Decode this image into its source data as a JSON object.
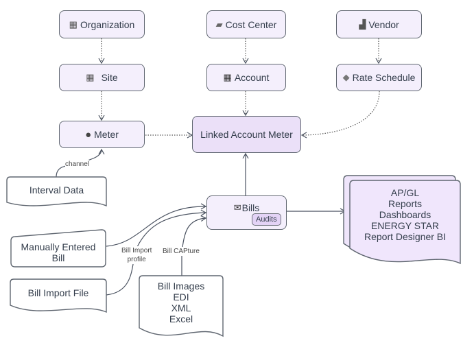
{
  "nodes": {
    "organization": {
      "label": "Organization",
      "icon": "building-icon"
    },
    "cost_center": {
      "label": "Cost Center",
      "icon": "folder-icon"
    },
    "vendor": {
      "label": "Vendor",
      "icon": "factory-icon"
    },
    "site": {
      "label": "Site",
      "icon": "office-building-icon"
    },
    "account": {
      "label": "Account",
      "icon": "calculator-icon"
    },
    "rate_schedule": {
      "label": "Rate Schedule",
      "icon": "tag-icon"
    },
    "meter": {
      "label": "Meter",
      "icon": "meter-icon"
    },
    "linked_account_meter": {
      "label": "Linked Account Meter"
    },
    "interval_data": {
      "label": "Interval Data"
    },
    "bills": {
      "label": "Bills",
      "icon": "envelope-icon",
      "badge": "Audits"
    },
    "manually_entered_bill": {
      "label_line1": "Manually Entered",
      "label_line2": "Bill"
    },
    "bill_import_file": {
      "label": "Bill Import File"
    },
    "bill_sources": {
      "lines": [
        "Bill Images",
        "EDI",
        "XML",
        "Excel"
      ]
    },
    "outputs": {
      "lines": [
        "AP/GL",
        "Reports",
        "Dashboards",
        "ENERGY STAR",
        "Report Designer BI"
      ]
    }
  },
  "edge_labels": {
    "channel": "channel",
    "bill_import_profile_1": "Bill Import",
    "bill_import_profile_2": "profile",
    "bill_capture": "Bill CAPture"
  }
}
